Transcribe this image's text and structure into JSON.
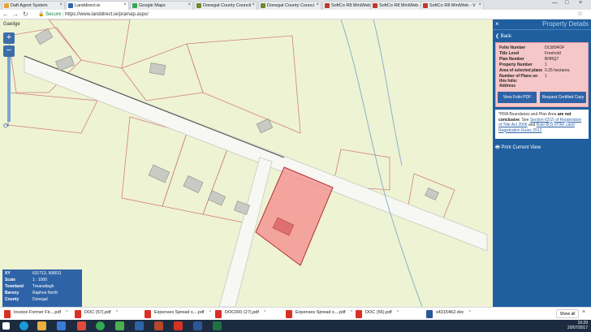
{
  "tabs": [
    {
      "label": "Daft Agent System",
      "active": false,
      "color": "#e8a33d"
    },
    {
      "label": "Landdirect.ie",
      "active": true,
      "color": "#2e63a7"
    },
    {
      "label": "Google Maps",
      "active": false,
      "color": "#34a853"
    },
    {
      "label": "Donegal County Council",
      "active": false,
      "color": "#6d8a2d"
    },
    {
      "label": "Donegal County Counci",
      "active": false,
      "color": "#6d8a2d"
    },
    {
      "label": "SoftCo R8 MiniWeb - V",
      "active": false,
      "color": "#c0392b"
    },
    {
      "label": "SoftCo R8 MiniWeb - V",
      "active": false,
      "color": "#c0392b"
    },
    {
      "label": "SoftCo R8 MiniWeb - V",
      "active": false,
      "color": "#c0392b"
    }
  ],
  "address": {
    "secure_label": "Secure",
    "url": "https://www.landdirect.ie/pramap.aspx/"
  },
  "map": {
    "layer_label": "Gaeilge",
    "zoom_in": "+",
    "zoom_out": "−"
  },
  "info": {
    "rows": [
      {
        "key": "XY",
        "value": "631713, 908011"
      },
      {
        "key": "Scale",
        "value": "1 : 1000"
      },
      {
        "key": "Townland",
        "value": "Treanaltagh"
      },
      {
        "key": "Barony",
        "value": "Raphoe North"
      },
      {
        "key": "County",
        "value": "Donegal"
      }
    ]
  },
  "panel": {
    "close": "×",
    "title": "Property Details",
    "back": "Back",
    "folio_rows": [
      {
        "key": "Folio Number",
        "value": "DL5894OF"
      },
      {
        "key": "Title Level",
        "value": "Freehold"
      },
      {
        "key": "Plan Number",
        "value": "BHRQ7"
      },
      {
        "key": "Property Number",
        "value": "1"
      },
      {
        "key": "Area of selected plans",
        "value": "0.25 hectares."
      },
      {
        "key": "Number of Plans on this folio:",
        "value": "1"
      },
      {
        "key": "Address",
        "value": ""
      }
    ],
    "view_folio": "View Folio PDF",
    "request_copy": "Request Certified Copy",
    "notice_a": "*PRA Boundaries and Plan Area ",
    "notice_b": "are not conclusive",
    "notice_c": ". See ",
    "notice_link1": "Section 62(2) of Registration of Title Act 2006",
    "notice_d": " and ",
    "notice_link2": "Rule 8(3) of the Land Registration Rules 2012",
    "print": "Print Current View"
  },
  "downloads": [
    {
      "name": "Invoice Former Fir....pdf"
    },
    {
      "name": "DOC (57).pdf"
    },
    {
      "name": "Expenses Spread s....pdf"
    },
    {
      "name": "DOC000 (27).pdf"
    },
    {
      "name": "Expenses Spread s....pdf"
    },
    {
      "name": "DOC (56).pdf"
    },
    {
      "name": "s4315462.doc"
    }
  ],
  "show_all": "Show all",
  "clock": {
    "time": "16:29",
    "date": "20/07/2017"
  }
}
